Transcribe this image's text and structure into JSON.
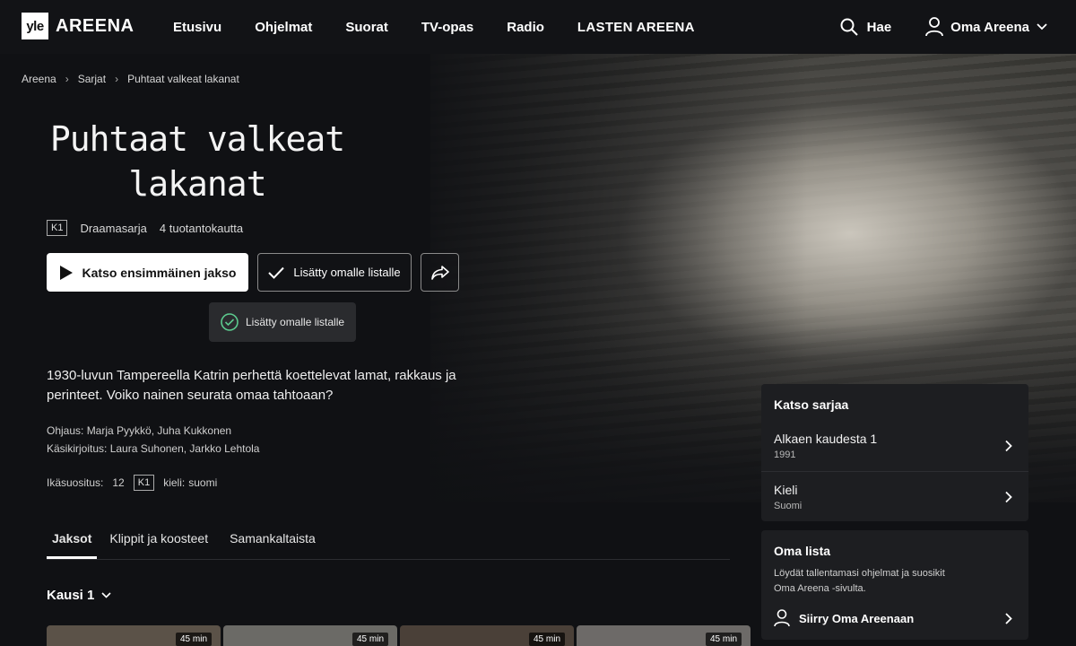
{
  "nav": {
    "logo_yle": "yle",
    "logo_areena": "AREENA",
    "links": [
      "Etusivu",
      "Ohjelmat",
      "Suorat",
      "TV-opas",
      "Radio",
      "LASTEN AREENA"
    ],
    "search_label": "Hae",
    "user_label": "Oma Areena"
  },
  "breadcrumb": [
    "Areena",
    "Sarjat",
    "Puhtaat valkeat lakanat"
  ],
  "title_line1": "Puhtaat valkeat",
  "title_line2": "lakanat",
  "meta": {
    "badge": "K1",
    "genre": "Draamasarja",
    "seasons": "4 tuotantokautta"
  },
  "buttons": {
    "watch": "Katso ensimmäinen jakso",
    "added": "Lisätty omalle listalle"
  },
  "toast": "Lisätty omalle listalle",
  "description": "1930-luvun Tampereella Katrin perhettä koettelevat lamat, rakkaus ja perinteet. Voiko nainen seurata omaa tahtoaan?",
  "credits": {
    "directors": "Ohjaus: Marja Pyykkö, Juha Kukkonen",
    "writers": "Käsikirjoitus: Laura Suhonen, Jarkko Lehtola"
  },
  "ratings": {
    "age_label": "Ikäsuositus:",
    "age_value": "12",
    "badge": "K1",
    "lang_label": "kieli:",
    "lang_value": "suomi"
  },
  "tabs": [
    "Jaksot",
    "Klippit ja koosteet",
    "Samankaltaista"
  ],
  "season": "Kausi 1",
  "thumbs": [
    {
      "duration": "45 min",
      "color": "#5b5248"
    },
    {
      "duration": "45 min",
      "color": "#6b6a66"
    },
    {
      "duration": "45 min",
      "color": "#4a4038"
    },
    {
      "duration": "45 min",
      "color": "#6d6a68"
    }
  ],
  "side_watch": {
    "heading": "Katso sarjaa",
    "rows": [
      {
        "title": "Alkaen kaudesta 1",
        "sub": "1991"
      },
      {
        "title": "Kieli",
        "sub": "Suomi"
      }
    ]
  },
  "side_list": {
    "heading": "Oma lista",
    "body": "Löydät tallentamasi ohjelmat ja suosikit Oma Areena -sivulta.",
    "cta": "Siirry Oma Areenaan"
  }
}
